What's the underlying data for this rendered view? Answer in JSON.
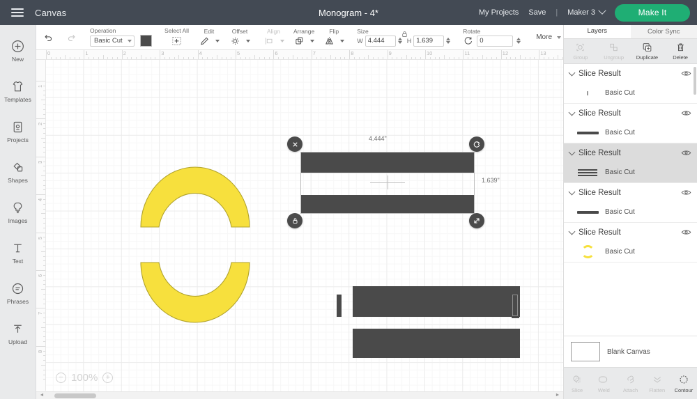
{
  "topbar": {
    "menu_icon": "hamburger-icon",
    "canvas_label": "Canvas",
    "project_title": "Monogram - 4*",
    "my_projects": "My Projects",
    "save": "Save",
    "separator": "|",
    "machine": "Maker 3",
    "make_it": "Make It",
    "bg_color": "#434a54",
    "accent_green": "#1fae74"
  },
  "sidebar": {
    "items": [
      {
        "label": "New",
        "icon": "plus-circle-icon"
      },
      {
        "label": "Templates",
        "icon": "shirt-icon"
      },
      {
        "label": "Projects",
        "icon": "projects-icon"
      },
      {
        "label": "Shapes",
        "icon": "shapes-icon"
      },
      {
        "label": "Images",
        "icon": "lightbulb-icon"
      },
      {
        "label": "Text",
        "icon": "text-t-icon"
      },
      {
        "label": "Phrases",
        "icon": "speech-bubble-icon"
      },
      {
        "label": "Upload",
        "icon": "upload-arrow-icon"
      }
    ]
  },
  "toolbar": {
    "undo": "undo-icon",
    "redo": "redo-icon",
    "operation_label": "Operation",
    "operation_value": "Basic Cut",
    "operation_color": "#4a4a4a",
    "select_all_label": "Select All",
    "edit_label": "Edit",
    "offset_label": "Offset",
    "align_label": "Align",
    "arrange_label": "Arrange",
    "flip_label": "Flip",
    "size_label": "Size",
    "lock_icon": "lock-icon",
    "width_prefix": "W",
    "width_value": "4.444",
    "height_prefix": "H",
    "height_value": "1.639",
    "rotate_label": "Rotate",
    "rotate_value": "0",
    "more_label": "More"
  },
  "canvas": {
    "ruler_h_ticks": [
      "0",
      "1",
      "2",
      "3",
      "4",
      "5",
      "6",
      "7",
      "8",
      "9",
      "10",
      "11",
      "12",
      "13"
    ],
    "ruler_v_ticks": [
      "1",
      "2",
      "3",
      "4",
      "5",
      "6",
      "7",
      "8"
    ],
    "zoom_value": "100%",
    "zoom_out": "−",
    "zoom_in": "+",
    "selection": {
      "width_label": "4.444\"",
      "height_label": "1.639\"",
      "delete_handle": "close-icon",
      "rotate_handle": "rotate-icon",
      "lock_handle": "lock-icon",
      "resize_handle": "resize-icon"
    },
    "shape_colors": {
      "dark": "#4a4a4a",
      "yellow": "#f7e03d",
      "yellow_stroke": "#b9a92a"
    }
  },
  "right_panel": {
    "tabs": [
      {
        "label": "Layers",
        "active": true
      },
      {
        "label": "Color Sync",
        "active": false
      }
    ],
    "actions": [
      {
        "label": "Group",
        "icon": "group-icon",
        "disabled": true
      },
      {
        "label": "Ungroup",
        "icon": "ungroup-icon",
        "disabled": true
      },
      {
        "label": "Duplicate",
        "icon": "duplicate-icon",
        "disabled": false
      },
      {
        "label": "Delete",
        "icon": "trash-icon",
        "disabled": false
      }
    ],
    "layers": [
      {
        "name": "Slice Result",
        "child": "Basic Cut",
        "thumb": "tiny-sliver",
        "selected": false
      },
      {
        "name": "Slice Result",
        "child": "Basic Cut",
        "thumb": "solid-bar",
        "selected": false
      },
      {
        "name": "Slice Result",
        "child": "Basic Cut",
        "thumb": "double-bar",
        "selected": true
      },
      {
        "name": "Slice Result",
        "child": "Basic Cut",
        "thumb": "solid-bar",
        "selected": false
      },
      {
        "name": "Slice Result",
        "child": "Basic Cut",
        "thumb": "yellow-ring",
        "selected": false
      }
    ],
    "canvas_chip_label": "Blank Canvas",
    "bottom_tools": [
      {
        "label": "Slice",
        "icon": "slice-icon",
        "disabled": true
      },
      {
        "label": "Weld",
        "icon": "weld-icon",
        "disabled": true
      },
      {
        "label": "Attach",
        "icon": "attach-icon",
        "disabled": true
      },
      {
        "label": "Flatten",
        "icon": "flatten-icon",
        "disabled": true
      },
      {
        "label": "Contour",
        "icon": "contour-icon",
        "disabled": false
      }
    ]
  }
}
